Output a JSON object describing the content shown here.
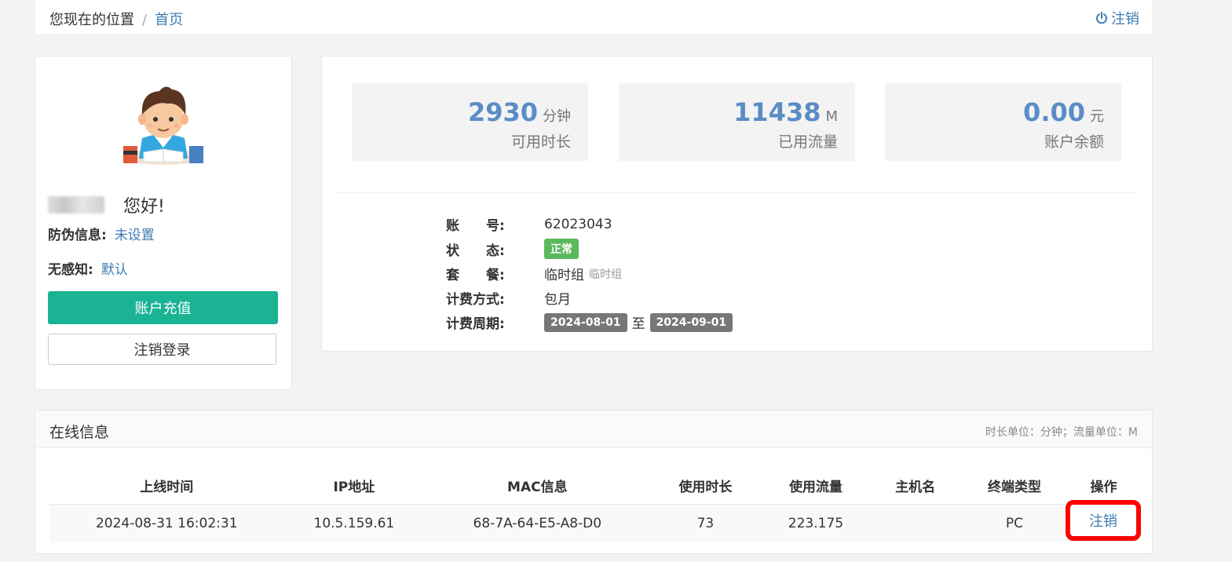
{
  "header": {
    "location_label": "您现在的位置",
    "separator": "/",
    "home_link": "首页",
    "logout_link": "注销"
  },
  "profile": {
    "greeting": "您好!",
    "anti_fake_label": "防伪信息:",
    "anti_fake_value": "未设置",
    "senseless_label": "无感知:",
    "senseless_value": "默认",
    "recharge_button": "账户充值",
    "logout_button": "注销登录"
  },
  "stats": [
    {
      "value": "2930",
      "unit": "分钟",
      "label": "可用时长"
    },
    {
      "value": "11438",
      "unit": "M",
      "label": "已用流量"
    },
    {
      "value": "0.00",
      "unit": "元",
      "label": "账户余额"
    }
  ],
  "account": {
    "account_label": "账　　号:",
    "account_value": "62023043",
    "status_label": "状　　态:",
    "status_value": "正常",
    "package_label": "套　　餐:",
    "package_value": "临时组",
    "package_sub": "临时组",
    "billing_label": "计费方式:",
    "billing_value": "包月",
    "period_label": "计费周期:",
    "period_start": "2024-08-01",
    "period_to": "至",
    "period_end": "2024-09-01"
  },
  "online": {
    "title": "在线信息",
    "units_note": "时长单位：分钟；流量单位：M",
    "columns": [
      "上线时间",
      "IP地址",
      "MAC信息",
      "使用时长",
      "使用流量",
      "主机名",
      "终端类型",
      "操作"
    ],
    "rows": [
      {
        "login_time": "2024-08-31 16:02:31",
        "ip": "10.5.159.61",
        "mac": "68-7A-64-E5-A8-D0",
        "duration": "73",
        "traffic": "223.175",
        "hostname": "",
        "terminal": "PC",
        "action": "注销"
      }
    ]
  },
  "colors": {
    "accent_green": "#1ab394",
    "link_blue": "#3c7cb4",
    "stat_blue": "#5b8cc5",
    "status_green": "#5cb85c",
    "highlight_red": "#ff0000"
  }
}
